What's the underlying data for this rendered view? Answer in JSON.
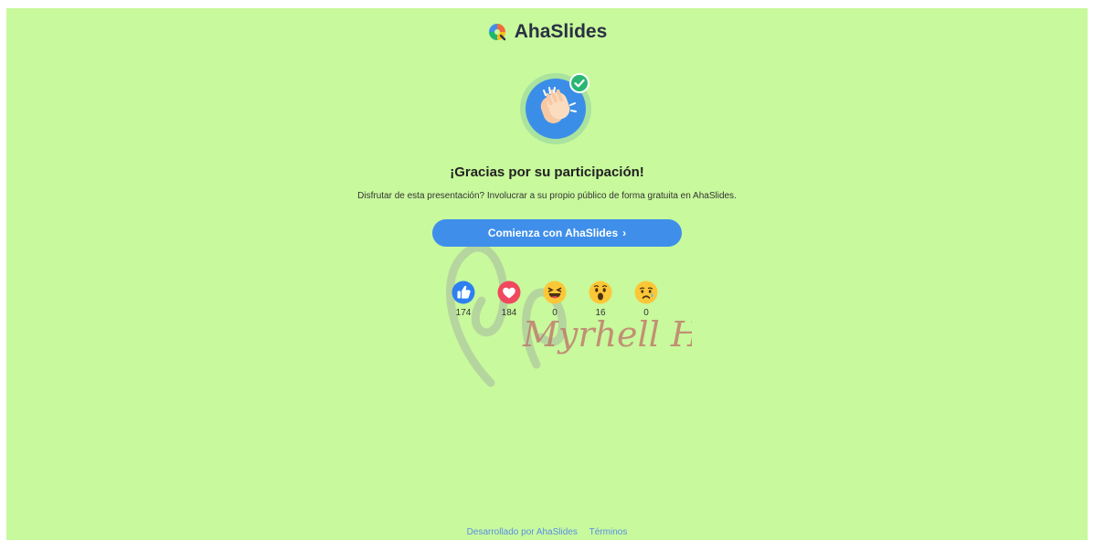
{
  "brand": {
    "name": "AhaSlides"
  },
  "main": {
    "title": "¡Gracias por su participación!",
    "subtitle": "Disfrutar de esta presentación? Involucrar a su propio público de forma gratuita en AhaSlides.",
    "cta_label": "Comienza con AhaSlides",
    "cta_arrow": "›"
  },
  "reactions": [
    {
      "icon": "thumbs-up-icon",
      "count": "174"
    },
    {
      "icon": "heart-icon",
      "count": "184"
    },
    {
      "icon": "laugh-icon",
      "count": "0"
    },
    {
      "icon": "wow-icon",
      "count": "16"
    },
    {
      "icon": "sad-icon",
      "count": "0"
    }
  ],
  "watermark": {
    "text": "Myrhell H."
  },
  "footer": {
    "powered_by": "Desarrollado por AhaSlides",
    "terms": "Términos"
  },
  "colors": {
    "background": "#c8f99d",
    "primary": "#3f8fea",
    "check": "#2bb673"
  }
}
